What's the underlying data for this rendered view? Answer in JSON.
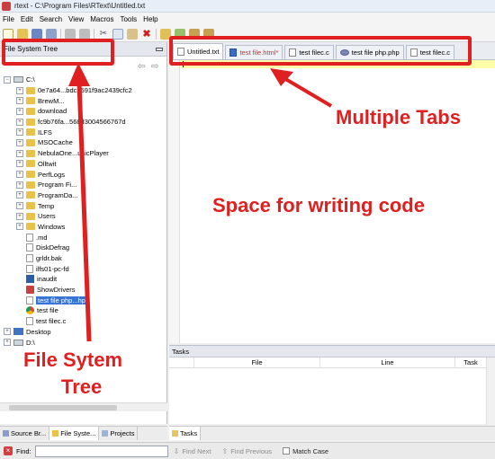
{
  "window": {
    "title": "rtext - C:\\Program Files\\RText\\Untitled.txt"
  },
  "menu": [
    "File",
    "Edit",
    "Search",
    "View",
    "Macros",
    "Tools",
    "Help"
  ],
  "left_panel": {
    "title": "File System Tree",
    "tree": [
      {
        "label": "C:\\",
        "icon": "drive",
        "level": 0,
        "exp": "-"
      },
      {
        "label": "0e7a64...bdc3591f9ac2439cfc2",
        "icon": "folder",
        "level": 1,
        "exp": "+"
      },
      {
        "label": "BrewM...",
        "icon": "folder",
        "level": 1,
        "exp": "+"
      },
      {
        "label": "download",
        "icon": "folder",
        "level": 1,
        "exp": "+"
      },
      {
        "label": "fc9b76fa...568d3004566767d",
        "icon": "folder",
        "level": 1,
        "exp": "+"
      },
      {
        "label": "ILFS",
        "icon": "folder",
        "level": 1,
        "exp": "+"
      },
      {
        "label": "MSOCache",
        "icon": "folder",
        "level": 1,
        "exp": "+"
      },
      {
        "label": "NebulaOne...usicPlayer",
        "icon": "folder",
        "level": 1,
        "exp": "+"
      },
      {
        "label": "Olltwit",
        "icon": "folder",
        "level": 1,
        "exp": "+"
      },
      {
        "label": "PerfLogs",
        "icon": "folder",
        "level": 1,
        "exp": "+"
      },
      {
        "label": "Program Fi...",
        "icon": "folder",
        "level": 1,
        "exp": "+"
      },
      {
        "label": "ProgramDa...",
        "icon": "folder",
        "level": 1,
        "exp": "+"
      },
      {
        "label": "Temp",
        "icon": "folder",
        "level": 1,
        "exp": "+"
      },
      {
        "label": "Users",
        "icon": "folder",
        "level": 1,
        "exp": "+"
      },
      {
        "label": "Windows",
        "icon": "folder",
        "level": 1,
        "exp": "+"
      },
      {
        "label": ".md",
        "icon": "file",
        "level": 1,
        "exp": ""
      },
      {
        "label": "DiskDefrag",
        "icon": "file",
        "level": 1,
        "exp": ""
      },
      {
        "label": "grldr.bak",
        "icon": "file",
        "level": 1,
        "exp": ""
      },
      {
        "label": "ilfs01-pc-fd",
        "icon": "file",
        "level": 1,
        "exp": ""
      },
      {
        "label": "inaudit",
        "icon": "exe",
        "level": 1,
        "exp": ""
      },
      {
        "label": "ShowDrivers",
        "icon": "red",
        "level": 1,
        "exp": ""
      },
      {
        "label": "test file php...hp",
        "icon": "file",
        "level": 1,
        "exp": "",
        "selected": true
      },
      {
        "label": "test file",
        "icon": "chrome",
        "level": 1,
        "exp": ""
      },
      {
        "label": "test filec.c",
        "icon": "file",
        "level": 1,
        "exp": ""
      },
      {
        "label": "Desktop",
        "icon": "desktop",
        "level": 0,
        "exp": "+"
      },
      {
        "label": "D:\\",
        "icon": "drive",
        "level": 0,
        "exp": "+"
      }
    ],
    "bottom_tabs": [
      "Source Br...",
      "File Syste...",
      "Projects"
    ]
  },
  "editor": {
    "tabs": [
      {
        "label": "Untitled.txt",
        "icon": "file",
        "active": true,
        "modified": false
      },
      {
        "label": "test file.html*",
        "icon": "html",
        "active": false,
        "modified": true
      },
      {
        "label": "test filec.c",
        "icon": "file",
        "active": false,
        "modified": false
      },
      {
        "label": "test file php.php",
        "icon": "php",
        "active": false,
        "modified": false
      },
      {
        "label": "test filec.c",
        "icon": "file",
        "active": false,
        "modified": false
      }
    ]
  },
  "tasks": {
    "title": "Tasks",
    "columns": [
      "",
      "File",
      "Line",
      "Task"
    ],
    "tab_label": "Tasks"
  },
  "findbar": {
    "label": "Find:",
    "value": "",
    "find_next": "Find Next",
    "find_previous": "Find Previous",
    "match_case": "Match Case"
  },
  "annotations": {
    "tabs_label": "Multiple Tabs",
    "editor_label": "Space for writing code",
    "tree_label_line1": "File Sytem",
    "tree_label_line2": "Tree",
    "color": "#e02020"
  }
}
